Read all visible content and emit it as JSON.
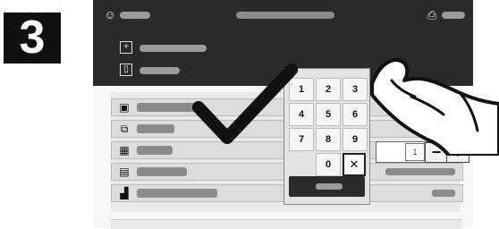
{
  "step": "3",
  "keypad": {
    "keys": [
      "1",
      "2",
      "3",
      "4",
      "5",
      "6",
      "7",
      "8",
      "9",
      "0"
    ],
    "clear_symbol": "✕"
  },
  "stepper": {
    "value": "1",
    "minus": "−",
    "plus": "+"
  },
  "icons": {
    "top_user": "user-icon",
    "top_printer": "printer-icon",
    "top_left_1": "document-icon",
    "top_left_2": "page-icon",
    "row_icons": [
      "doc-icon",
      "copy-icon",
      "tray-icon",
      "layout-icon",
      "finish-icon"
    ]
  },
  "colors": {
    "top_panel": "#2a2a2a",
    "row_bg": "#dcdcdc",
    "keypad_bg": "#e3e3e3"
  }
}
